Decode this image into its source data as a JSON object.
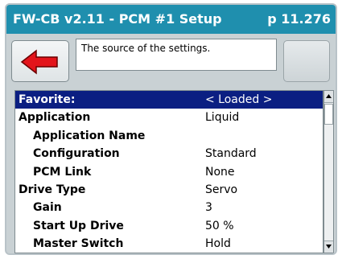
{
  "window": {
    "title": "FW-CB v2.11 - PCM #1 Setup",
    "page": "p 11.276"
  },
  "toolbar": {
    "help_text": "The source of the settings.",
    "back_icon": "left-arrow-icon"
  },
  "list": {
    "rows": [
      {
        "label": "Favorite:",
        "value": "< Loaded >",
        "selected": true,
        "indent": 0
      },
      {
        "label": "Application",
        "value": "Liquid",
        "indent": 0
      },
      {
        "label": "Application Name",
        "value": "",
        "indent": 1
      },
      {
        "label": "Configuration",
        "value": "Standard",
        "indent": 1
      },
      {
        "label": "PCM Link",
        "value": "None",
        "indent": 1
      },
      {
        "label": "Drive Type",
        "value": "Servo",
        "indent": 0
      },
      {
        "label": "Gain",
        "value": "3",
        "indent": 1
      },
      {
        "label": "Start Up Drive",
        "value": "50 %",
        "indent": 1
      },
      {
        "label": "Master Switch",
        "value": "Hold",
        "indent": 1
      }
    ]
  },
  "colors": {
    "titlebar": "#1f8fae",
    "selection": "#0b1f82",
    "back_arrow": "#e3141b"
  }
}
